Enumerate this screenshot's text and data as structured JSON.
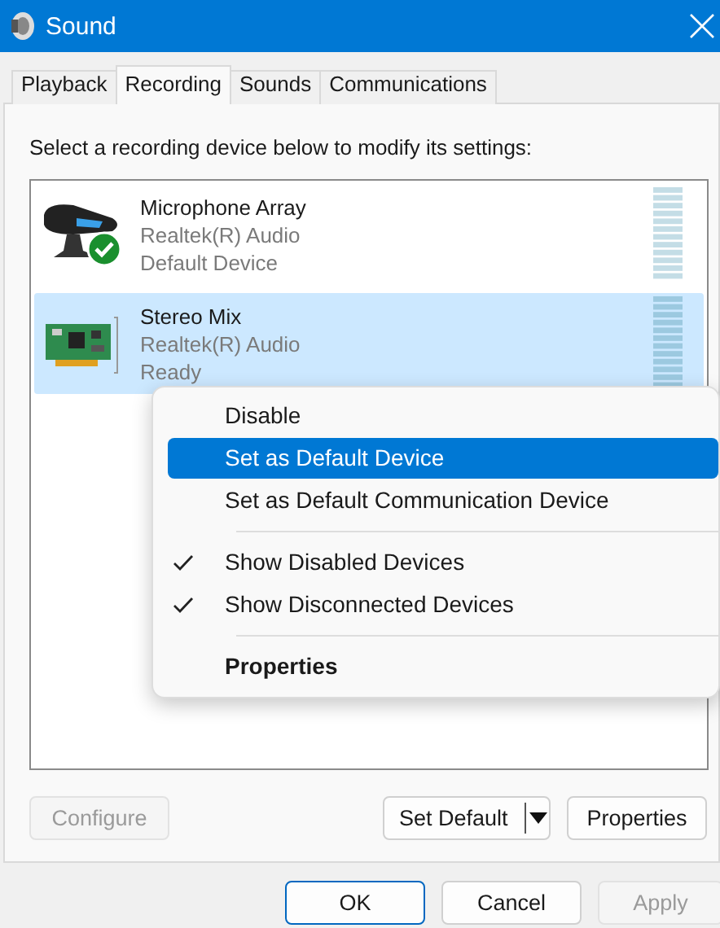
{
  "window": {
    "title": "Sound"
  },
  "tabs": [
    {
      "label": "Playback",
      "selected": false
    },
    {
      "label": "Recording",
      "selected": true
    },
    {
      "label": "Sounds",
      "selected": false
    },
    {
      "label": "Communications",
      "selected": false
    }
  ],
  "instruction": "Select a recording device below to modify its settings:",
  "devices": [
    {
      "kind": "microphone",
      "name": "Microphone Array",
      "driver": "Realtek(R) Audio",
      "status": "Default Device",
      "default": true,
      "selected": false
    },
    {
      "kind": "sound-card",
      "name": "Stereo Mix",
      "driver": "Realtek(R) Audio",
      "status": "Ready",
      "default": false,
      "selected": true
    }
  ],
  "context_menu": [
    {
      "kind": "item",
      "label": "Disable",
      "highlighted": false,
      "checked": false,
      "bold": false
    },
    {
      "kind": "item",
      "label": "Set as Default Device",
      "highlighted": true,
      "checked": false,
      "bold": false
    },
    {
      "kind": "item",
      "label": "Set as Default Communication Device",
      "highlighted": false,
      "checked": false,
      "bold": false
    },
    {
      "kind": "separator"
    },
    {
      "kind": "item",
      "label": "Show Disabled Devices",
      "highlighted": false,
      "checked": true,
      "bold": false
    },
    {
      "kind": "item",
      "label": "Show Disconnected Devices",
      "highlighted": false,
      "checked": true,
      "bold": false
    },
    {
      "kind": "separator"
    },
    {
      "kind": "item",
      "label": "Properties",
      "highlighted": false,
      "checked": false,
      "bold": true
    }
  ],
  "panel_buttons": [
    {
      "kind": "plain",
      "label": "Configure",
      "disabled": true
    },
    {
      "kind": "split",
      "label": "Set Default",
      "disabled": false
    },
    {
      "kind": "plain",
      "label": "Properties",
      "disabled": false
    }
  ],
  "dialog_buttons": [
    {
      "label": "OK",
      "focused": true,
      "disabled": false
    },
    {
      "label": "Cancel",
      "focused": false,
      "disabled": false
    },
    {
      "label": "Apply",
      "focused": false,
      "disabled": true
    }
  ]
}
